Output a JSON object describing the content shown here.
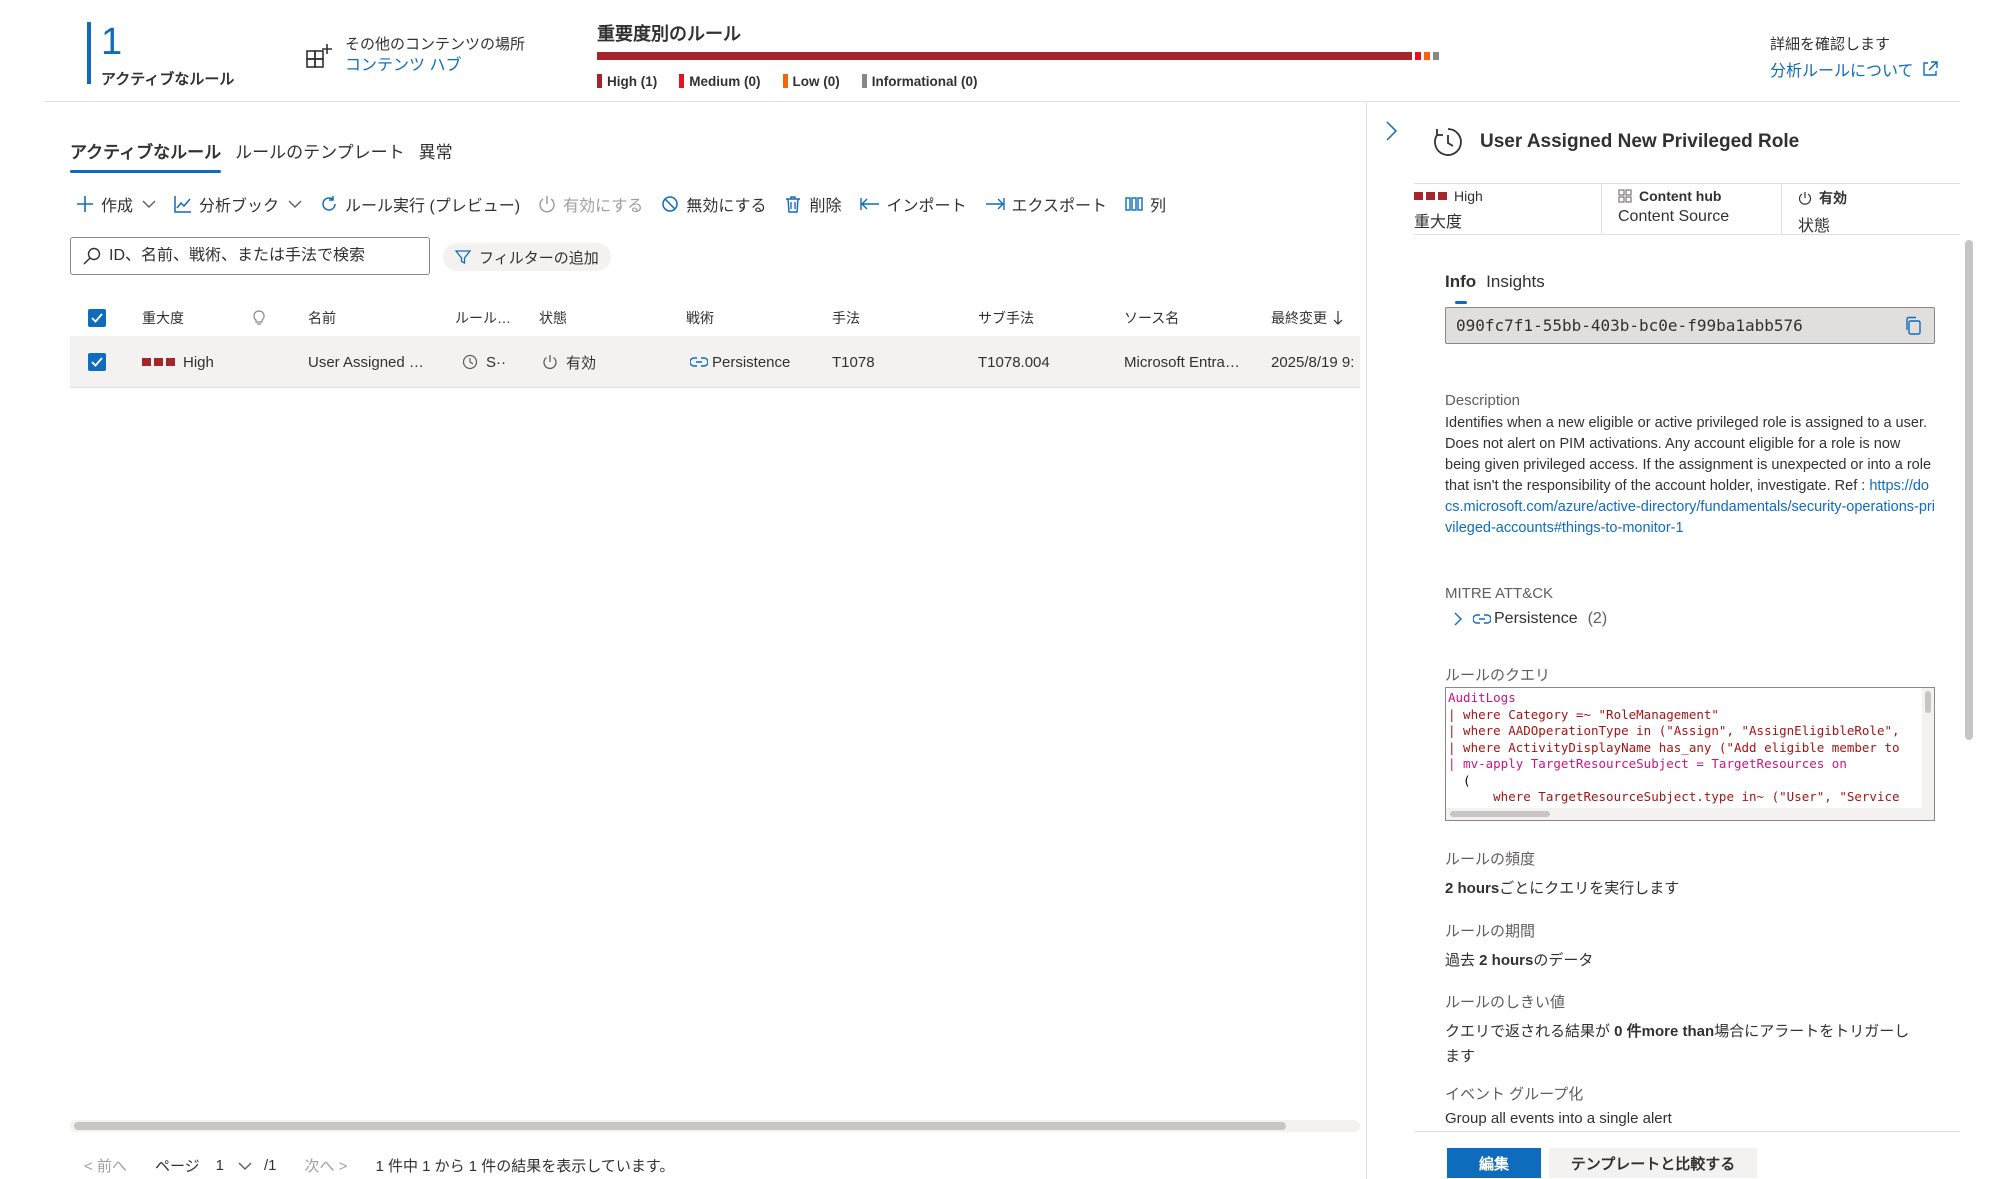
{
  "summary": {
    "active_count": "1",
    "active_label": "アクティブなルール",
    "content_location_label": "その他のコンテンツの場所",
    "content_hub_link": "コンテンツ ハブ",
    "severity_title": "重要度別のルール",
    "severity_levels": [
      {
        "label": "High (1)",
        "color": "#a4262c",
        "count": 1
      },
      {
        "label": "Medium (0)",
        "color": "#e81123",
        "count": 0
      },
      {
        "label": "Low (0)",
        "color": "#f7630c",
        "count": 0
      },
      {
        "label": "Informational (0)",
        "color": "#8a8886",
        "count": 0
      }
    ],
    "details_label": "詳細を確認します",
    "details_link": "分析ルールについて"
  },
  "tabs": [
    {
      "label": "アクティブなルール",
      "active": true
    },
    {
      "label": "ルールのテンプレート",
      "active": false
    },
    {
      "label": "異常",
      "active": false
    }
  ],
  "toolbar": {
    "create": "作成",
    "workbook": "分析ブック",
    "run_rule": "ルール実行 (プレビュー)",
    "enable": "有効にする",
    "disable": "無効にする",
    "delete": "削除",
    "import": "インポート",
    "export": "エクスポート",
    "columns": "列"
  },
  "search": {
    "placeholder": "ID、名前、戦術、または手法で検索"
  },
  "filter_button": "フィルターの追加",
  "table": {
    "headers": {
      "severity": "重大度",
      "name": "名前",
      "rule_type": "ルール…",
      "status": "状態",
      "tactics": "戦術",
      "techniques": "手法",
      "sub_techniques": "サブ手法",
      "source": "ソース名",
      "last_modified": "最終変更"
    },
    "rows": [
      {
        "severity": "High",
        "name": "User Assigned …",
        "rule_type": "S··",
        "status": "有効",
        "tactics": "Persistence",
        "techniques": "T1078",
        "sub_techniques": "T1078.004",
        "source": "Microsoft Entra…",
        "last_modified": "2025/8/19 9:"
      }
    ]
  },
  "pager": {
    "prev": "< 前へ",
    "page_label": "ページ",
    "page": "1",
    "total": "/1",
    "next": "次へ >",
    "summary": "1 件中 1 から 1 件の結果を表示しています。"
  },
  "panel": {
    "title": "User Assigned New Privileged Role",
    "severity_value": "High",
    "severity_label": "重大度",
    "source_value": "Content hub",
    "source_label": "Content Source",
    "status_value": "有効",
    "status_label": "状態",
    "sub_tabs": [
      "Info",
      "Insights"
    ],
    "rule_id": "090fc7f1-55bb-403b-bc0e-f99ba1abb576",
    "description_label": "Description",
    "description_text": "Identifies when a new eligible or active privileged role is assigned to a user. Does not alert on PIM activations. Any account eligible for a role is now being given privileged access. If the assignment is unexpected or into a role that isn't the responsibility of the account holder, investigate. Ref : ",
    "description_link": "https://docs.microsoft.com/azure/active-directory/fundamentals/security-operations-privileged-accounts#things-to-monitor-1",
    "mitre_label": "MITRE ATT&CK",
    "mitre_tactic": "Persistence",
    "mitre_count": "(2)",
    "query_label": "ルールのクエリ",
    "query_lines": [
      "AuditLogs",
      "| where Category =~ \"RoleManagement\"",
      "| where AADOperationType in (\"Assign\", \"AssignEligibleRole\",",
      "| where ActivityDisplayName has_any (\"Add eligible member to",
      "| mv-apply TargetResourceSubject = TargetResources on",
      "  (",
      "      where TargetResourceSubject.type in~ (\"User\", \"Service"
    ],
    "frequency_label": "ルールの頻度",
    "frequency_bold": "2 hours",
    "frequency_text": "ごとにクエリを実行します",
    "period_label": "ルールの期間",
    "period_prefix": "過去 ",
    "period_bold": "2 hours",
    "period_suffix": "のデータ",
    "threshold_label": "ルールのしきい値",
    "threshold_prefix": "クエリで返される結果が ",
    "threshold_bold": "0 件more than",
    "threshold_suffix": "場合にアラートをトリガーし",
    "threshold_wrap": "ます",
    "grouping_label": "イベント グループ化",
    "grouping_value": "Group all events into a single alert",
    "edit_button": "編集",
    "compare_button": "テンプレートと比較する"
  }
}
